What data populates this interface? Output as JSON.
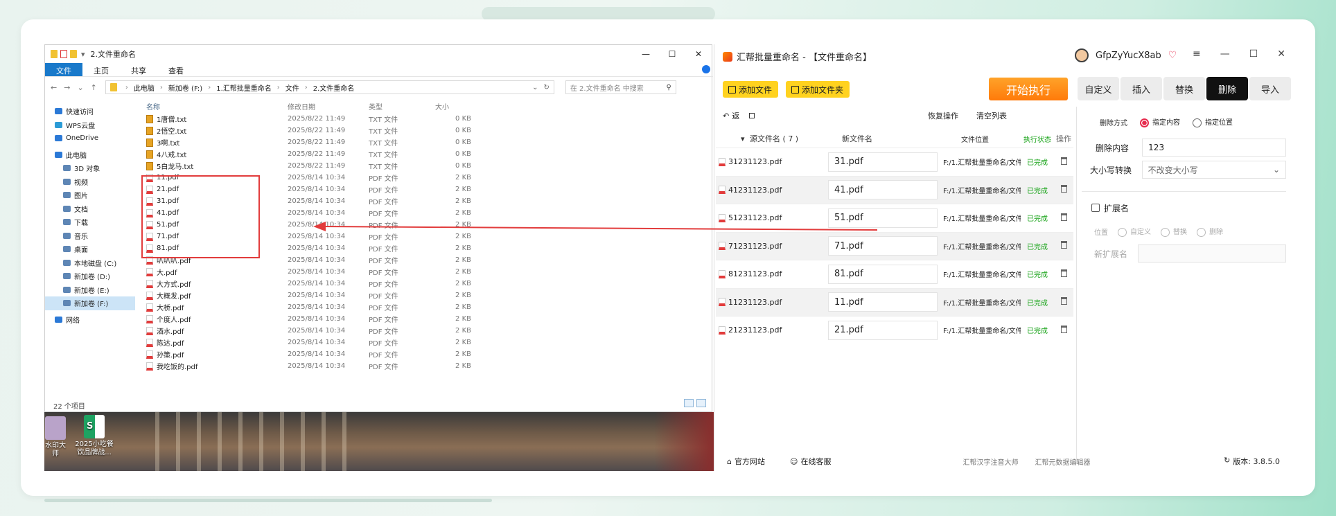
{
  "explorer": {
    "title": "2.文件重命名",
    "window_controls": {
      "minimize": "—",
      "maximize": "☐",
      "close": "✕"
    },
    "ribbon": [
      "文件",
      "主页",
      "共享",
      "查看"
    ],
    "breadcrumb": [
      "此电脑",
      "新加卷 (F:)",
      "1.汇帮批量重命名",
      "文件",
      "2.文件重命名"
    ],
    "search_placeholder": "在 2.文件重命名 中搜索",
    "nav": [
      "快速访问",
      "WPS云盘",
      "OneDrive",
      "此电脑",
      "3D 对象",
      "视频",
      "图片",
      "文档",
      "下载",
      "音乐",
      "桌面",
      "本地磁盘 (C:)",
      "新加卷 (D:)",
      "新加卷 (E:)",
      "新加卷 (F:)",
      "网络"
    ],
    "columns": {
      "name": "名称",
      "date": "修改日期",
      "type": "类型",
      "size": "大小"
    },
    "files": [
      {
        "name": "1唐僧.txt",
        "date": "2025/8/22 11:49",
        "type": "TXT 文件",
        "size": "0 KB",
        "kind": "txt"
      },
      {
        "name": "2悟空.txt",
        "date": "2025/8/22 11:49",
        "type": "TXT 文件",
        "size": "0 KB",
        "kind": "txt"
      },
      {
        "name": "3啊.txt",
        "date": "2025/8/22 11:49",
        "type": "TXT 文件",
        "size": "0 KB",
        "kind": "txt"
      },
      {
        "name": "4八戒.txt",
        "date": "2025/8/22 11:49",
        "type": "TXT 文件",
        "size": "0 KB",
        "kind": "txt"
      },
      {
        "name": "5白龙马.txt",
        "date": "2025/8/22 11:49",
        "type": "TXT 文件",
        "size": "0 KB",
        "kind": "txt"
      },
      {
        "name": "11.pdf",
        "date": "2025/8/14 10:34",
        "type": "PDF 文件",
        "size": "2 KB",
        "kind": "pdf"
      },
      {
        "name": "21.pdf",
        "date": "2025/8/14 10:34",
        "type": "PDF 文件",
        "size": "2 KB",
        "kind": "pdf"
      },
      {
        "name": "31.pdf",
        "date": "2025/8/14 10:34",
        "type": "PDF 文件",
        "size": "2 KB",
        "kind": "pdf"
      },
      {
        "name": "41.pdf",
        "date": "2025/8/14 10:34",
        "type": "PDF 文件",
        "size": "2 KB",
        "kind": "pdf"
      },
      {
        "name": "51.pdf",
        "date": "2025/8/14 10:34",
        "type": "PDF 文件",
        "size": "2 KB",
        "kind": "pdf"
      },
      {
        "name": "71.pdf",
        "date": "2025/8/14 10:34",
        "type": "PDF 文件",
        "size": "2 KB",
        "kind": "pdf"
      },
      {
        "name": "81.pdf",
        "date": "2025/8/14 10:34",
        "type": "PDF 文件",
        "size": "2 KB",
        "kind": "pdf"
      },
      {
        "name": "叭叭叭.pdf",
        "date": "2025/8/14 10:34",
        "type": "PDF 文件",
        "size": "2 KB",
        "kind": "pdf"
      },
      {
        "name": "大.pdf",
        "date": "2025/8/14 10:34",
        "type": "PDF 文件",
        "size": "2 KB",
        "kind": "pdf"
      },
      {
        "name": "大方式.pdf",
        "date": "2025/8/14 10:34",
        "type": "PDF 文件",
        "size": "2 KB",
        "kind": "pdf"
      },
      {
        "name": "大概发.pdf",
        "date": "2025/8/14 10:34",
        "type": "PDF 文件",
        "size": "2 KB",
        "kind": "pdf"
      },
      {
        "name": "大桥.pdf",
        "date": "2025/8/14 10:34",
        "type": "PDF 文件",
        "size": "2 KB",
        "kind": "pdf"
      },
      {
        "name": "个度人.pdf",
        "date": "2025/8/14 10:34",
        "type": "PDF 文件",
        "size": "2 KB",
        "kind": "pdf"
      },
      {
        "name": "酒水.pdf",
        "date": "2025/8/14 10:34",
        "type": "PDF 文件",
        "size": "2 KB",
        "kind": "pdf"
      },
      {
        "name": "陈达.pdf",
        "date": "2025/8/14 10:34",
        "type": "PDF 文件",
        "size": "2 KB",
        "kind": "pdf"
      },
      {
        "name": "孙策.pdf",
        "date": "2025/8/14 10:34",
        "type": "PDF 文件",
        "size": "2 KB",
        "kind": "pdf"
      },
      {
        "name": "我吃饭的.pdf",
        "date": "2025/8/14 10:34",
        "type": "PDF 文件",
        "size": "2 KB",
        "kind": "pdf"
      }
    ],
    "status": "22 个项目"
  },
  "desktop": {
    "icons": [
      {
        "label": "水印大\n师"
      },
      {
        "label": "2025小吃餐\n饮品牌战..."
      }
    ]
  },
  "app": {
    "title": "汇帮批量重命名 - 【文件重命名】",
    "user": "GfpZyYucX8ab",
    "window_controls": {
      "menu": "≡",
      "minimize": "—",
      "maximize": "☐",
      "close": "✕"
    },
    "add_file": "添加文件",
    "add_folder": "添加文件夹",
    "start": "开始执行",
    "tabs": [
      "自定义",
      "插入",
      "替换",
      "删除",
      "导入"
    ],
    "active_tab": "删除",
    "back": "返",
    "restore": "恢复操作",
    "clear": "清空列表",
    "table_head": {
      "src": "源文件名 ( 7 )",
      "new": "新文件名",
      "loc": "文件位置",
      "status": "执行状态",
      "op": "操作"
    },
    "rows": [
      {
        "src": "31231123.pdf",
        "new": "31.pdf",
        "loc": "F:/1.汇帮批量重命名/文件",
        "status": "已完成"
      },
      {
        "src": "41231123.pdf",
        "new": "41.pdf",
        "loc": "F:/1.汇帮批量重命名/文件",
        "status": "已完成"
      },
      {
        "src": "51231123.pdf",
        "new": "51.pdf",
        "loc": "F:/1.汇帮批量重命名/文件",
        "status": "已完成"
      },
      {
        "src": "71231123.pdf",
        "new": "71.pdf",
        "loc": "F:/1.汇帮批量重命名/文件",
        "status": "已完成"
      },
      {
        "src": "81231123.pdf",
        "new": "81.pdf",
        "loc": "F:/1.汇帮批量重命名/文件",
        "status": "已完成"
      },
      {
        "src": "11231123.pdf",
        "new": "11.pdf",
        "loc": "F:/1.汇帮批量重命名/文件",
        "status": "已完成"
      },
      {
        "src": "21231123.pdf",
        "new": "21.pdf",
        "loc": "F:/1.汇帮批量重命名/文件",
        "status": "已完成"
      }
    ],
    "panel": {
      "delete_mode_label": "删除方式",
      "opt_content": "指定内容",
      "opt_position": "指定位置",
      "delete_content_label": "删除内容",
      "delete_content_value": "123",
      "case_label": "大小写转换",
      "case_value": "不改变大小写",
      "ext_label": "扩展名",
      "pos_label": "位置",
      "pos_opts": [
        "自定义",
        "替换",
        "删除"
      ],
      "new_ext_label": "新扩展名"
    },
    "footer": {
      "site": "官方网站",
      "service": "在线客服",
      "link1": "汇帮汉字注音大师",
      "link2": "汇帮元数据编辑器",
      "version": "版本: 3.8.5.0"
    }
  },
  "colors": {
    "accent": "#ff8a14",
    "highlight": "#e23c3c",
    "success": "#17a317",
    "explorer_blue": "#1979ca"
  }
}
